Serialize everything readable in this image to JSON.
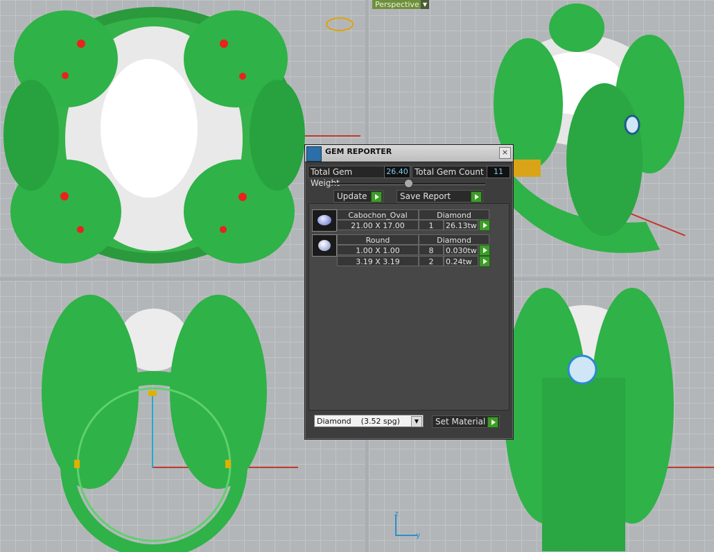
{
  "viewport": {
    "perspective_label": "Perspective",
    "axis_y_label": "y",
    "axis_z_label": "z"
  },
  "dialog": {
    "title": "GEM REPORTER",
    "close_glyph": "×",
    "total_weight_label": "Total Gem Weight",
    "total_weight_value": "26.40",
    "total_count_label": "Total Gem Count",
    "total_count_value": "11",
    "update_label": "Update",
    "save_report_label": "Save Report",
    "groups": [
      {
        "shape": "Cabochon_Oval",
        "material": "Diamond",
        "rows": [
          {
            "size": "21.00 X 17.00",
            "count": "1",
            "weight": "26.13tw"
          }
        ]
      },
      {
        "shape": "Round",
        "material": "Diamond",
        "rows": [
          {
            "size": "1.00 X 1.00",
            "count": "8",
            "weight": "0.030tw"
          },
          {
            "size": "3.19 X 3.19",
            "count": "2",
            "weight": "0.24tw"
          }
        ]
      }
    ],
    "material_select": "Diamond    (3.52 spg)",
    "set_material_label": "Set Material"
  },
  "colors": {
    "model_green": "#2fb247",
    "gem_white": "#f4f4f4",
    "accent_blue": "#7ecdf0"
  }
}
